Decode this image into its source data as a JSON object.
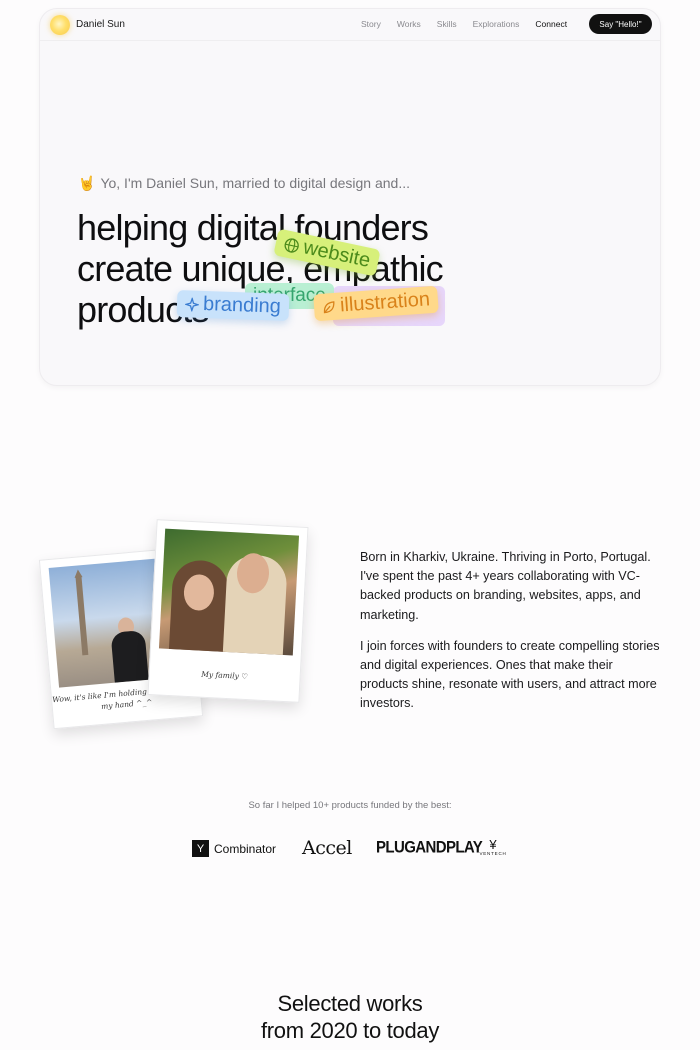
{
  "nav": {
    "brand": "Daniel Sun",
    "links": [
      "Story",
      "Works",
      "Skills",
      "Explorations",
      "Connect"
    ],
    "cta": "Say \"Hello!\""
  },
  "hero": {
    "intro_emoji": "🤘",
    "intro": "Yo, I'm Daniel Sun, married to digital design and...",
    "headline_lines": [
      "helping digital founders",
      "create unique, empathic",
      "products"
    ],
    "tags": {
      "website": "website",
      "interface": "interface",
      "branding": "branding",
      "illustration": "illustration"
    }
  },
  "photos": {
    "caption_1": "Wow, it's like I'm holding an obelisk on my hand ^_^",
    "caption_2": "My family ♡"
  },
  "bio": {
    "p1": "Born in Kharkiv, Ukraine. Thriving in Porto, Portugal. I've spent the past 4+ years collaborating with VC-backed products on branding, websites, apps, and marketing.",
    "p2": "I join forces with founders to create compelling stories and digital experiences. Ones that make their products shine, resonate with users, and attract more investors."
  },
  "investors": {
    "heading": "So far I helped 10+ products funded by the best:",
    "yc_mark": "Y",
    "yc_name": "Combinator",
    "accel": "Accel",
    "plugandplay": "PLUGANDPLAY",
    "ventech_mark": "¥",
    "ventech": "VENTECH"
  },
  "works": {
    "title_line1": "Selected works",
    "title_line2": "from 2020 to today"
  },
  "colors": {
    "website_tag": "#d7f07a",
    "interface_tag": "#b9efd3",
    "branding_tag": "#c8e2fb",
    "illustration_tag": "#ffd98a",
    "cta_bg": "#111111"
  }
}
